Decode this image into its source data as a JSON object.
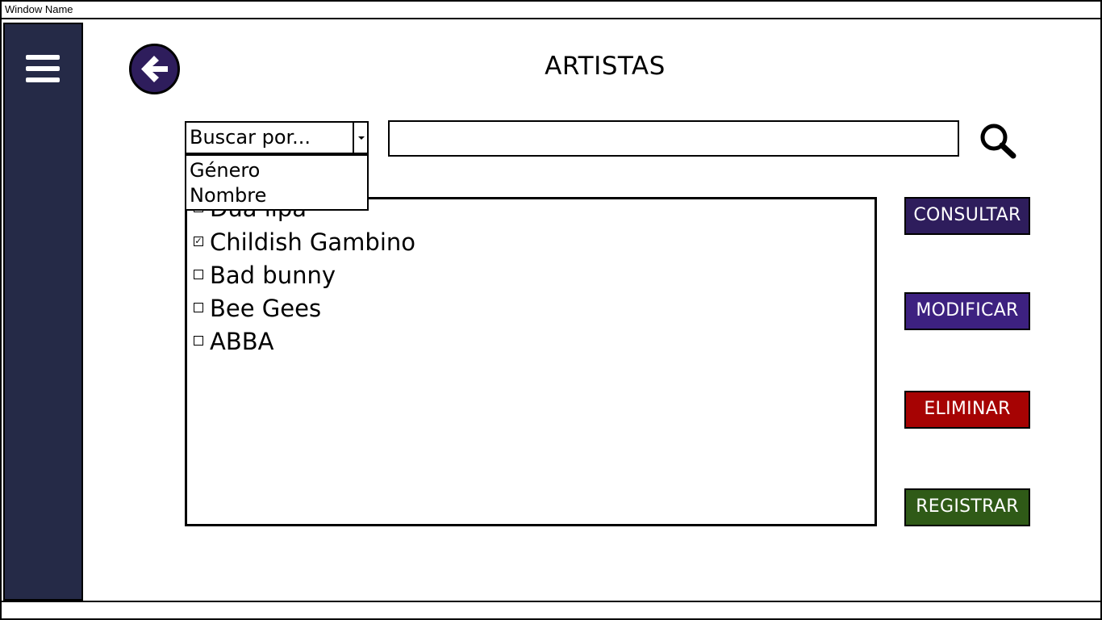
{
  "window": {
    "title": "Window Name"
  },
  "page": {
    "title": "ARTISTAS"
  },
  "search": {
    "select_value": "Buscar por...",
    "options": [
      "Género",
      "Nombre"
    ],
    "input_value": "",
    "input_placeholder": ""
  },
  "list": {
    "items": [
      {
        "label": "Dua lipa",
        "checked": false
      },
      {
        "label": "Childish Gambino",
        "checked": true
      },
      {
        "label": "Bad bunny",
        "checked": false
      },
      {
        "label": "Bee Gees",
        "checked": false
      },
      {
        "label": "ABBA",
        "checked": false
      }
    ]
  },
  "actions": {
    "consultar": "CONSULTAR",
    "modificar": "MODIFICAR",
    "eliminar": "ELIMINAR",
    "registrar": "REGISTRAR"
  },
  "colors": {
    "sidebar": "#252a47",
    "back_button": "#2e1d5c",
    "consultar": "#2e1d5c",
    "modificar": "#3d2180",
    "eliminar": "#a60303",
    "registrar": "#2f5a17"
  },
  "icons": {
    "menu": "hamburger-menu-icon",
    "back": "arrow-left-icon",
    "search": "magnifier-icon",
    "dropdown": "chevron-down-icon"
  }
}
